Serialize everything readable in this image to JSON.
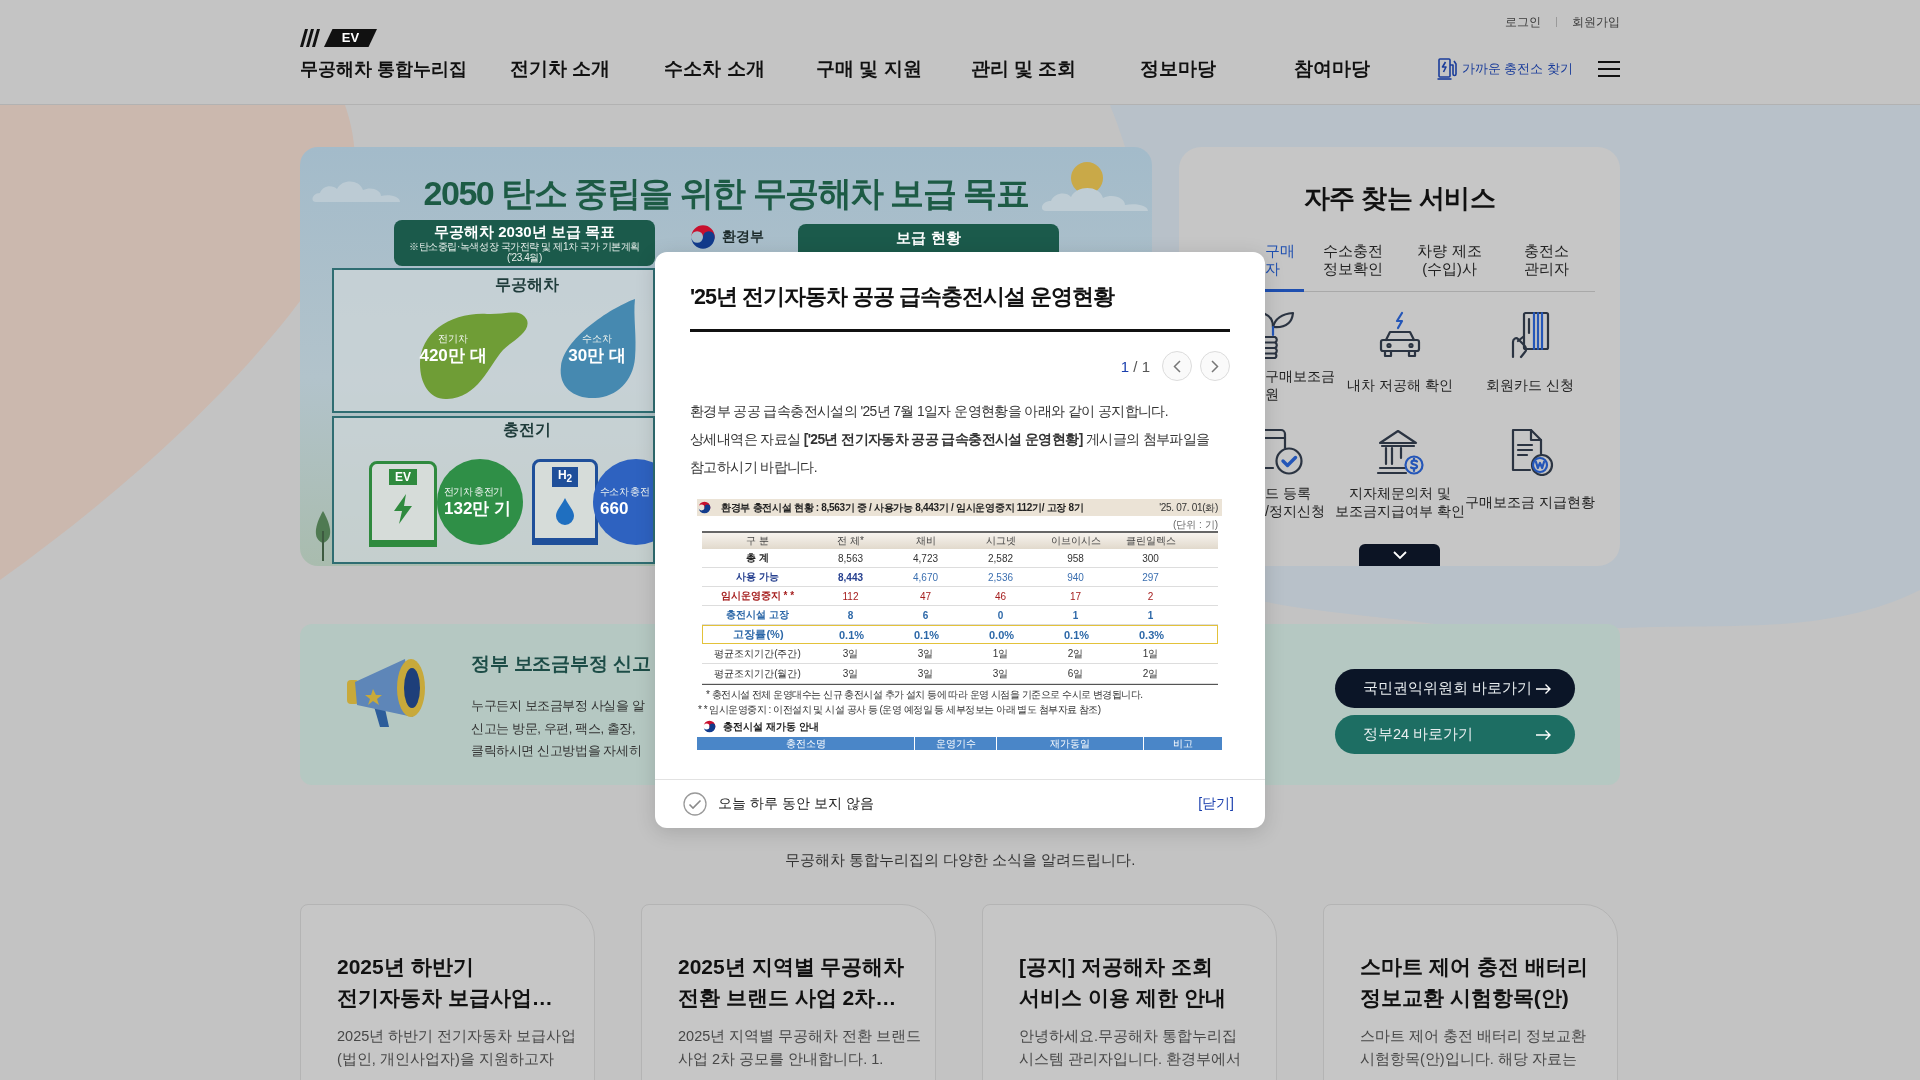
{
  "header": {
    "logo_badge": "EV",
    "site_title": "무공해차 통합누리집",
    "top_links": [
      "로그인",
      "회원가입"
    ],
    "nav": [
      "전기차 소개",
      "수소차 소개",
      "구매 및 지원",
      "관리 및 조회",
      "정보마당",
      "참여마당"
    ],
    "charger_search": "가까운 충전소 찾기"
  },
  "banner": {
    "title": "2050 탄소 중립을 위한 무공해차 보급 목표",
    "goal_heading": "무공해차 2030년 보급 목표",
    "goal_note": "※탄소중립·녹색성장 국가전략 및 제1차 국가 기본계획('23.4월)",
    "ministry": "환경부",
    "status_heading": "보급 현황",
    "vehicles_label": "무공해차",
    "vehicle_targets": [
      {
        "kind": "ev",
        "name": "전기차",
        "value": "420만 대"
      },
      {
        "kind": "hydrogen",
        "name": "수소차",
        "value": "30만 대"
      }
    ],
    "chargers_label": "충전기",
    "charger_targets": [
      {
        "kind": "ev",
        "pump_label": "EV",
        "name": "전기차 충전기",
        "value": "132만 기"
      },
      {
        "kind": "hydrogen",
        "pump_label": "H$_{2}$",
        "name": "수소차 충전",
        "value": "660"
      }
    ]
  },
  "services": {
    "title": "자주 찾는 서비스",
    "tabs": [
      {
        "label": "구매\n자",
        "selected": true
      },
      {
        "label": "수소충전\n정보확인",
        "selected": false
      },
      {
        "label": "차량 제조\n(수입)사",
        "selected": false
      },
      {
        "label": "충전소\n관리자",
        "selected": false
      }
    ],
    "items": [
      {
        "kind": "partial",
        "label": "구매보조금\n원"
      },
      {
        "kind": "full",
        "label": "내차 저공해 확인"
      },
      {
        "kind": "full",
        "label": "회원카드 신청"
      },
      {
        "kind": "partial",
        "label": "드 등록\n/정지신청"
      },
      {
        "kind": "full",
        "label": "지자체문의처 및\n보조금지급여부 확인"
      },
      {
        "kind": "full",
        "label": "구매보조금 지급현황"
      }
    ]
  },
  "report": {
    "title": "정부 보조금부정 신고",
    "text": "누구든지 보조금부정 사실을 알\n신고는 방문, 우편, 팩스, 출장,\n클릭하시면 신고방법을 자세히",
    "buttons": [
      {
        "kind": "dark",
        "label": "국민권익위원회 바로가기"
      },
      {
        "kind": "teal",
        "label": "정부24 바로가기"
      }
    ]
  },
  "news": {
    "subtitle": "무공해차 통합누리집의 다양한 소식을 알려드립니다.",
    "cards": [
      {
        "title": "2025년 하반기\n전기자동차 보급사업…",
        "summary": "2025년 하반기 전기자동차 보급사업\n(법인, 개인사업자)을 지원하고자"
      },
      {
        "title": "2025년 지역별 무공해차\n전환 브랜드 사업 2차…",
        "summary": "2025년 지역별 무공해차 전환 브랜드\n사업 2차 공모를 안내합니다. 1."
      },
      {
        "title": "[공지] 저공해차 조회\n서비스 이용 제한 안내",
        "summary": "안녕하세요.무공해차 통합누리집\n시스템 관리자입니다. 환경부에서"
      },
      {
        "title": "스마트 제어 충전 배터리\n정보교환 시험항목(안)",
        "summary": "스마트 제어 충전 배터리 정보교환\n시험항목(안)입니다. 해당 자료는"
      }
    ]
  },
  "notice_popup": {
    "title": "'25년 전기자동차 공공 급속충전시설 운영현황",
    "pager": {
      "current": "1",
      "separator": "/",
      "total": "1"
    },
    "body": "환경부 공공 급속충전시설의 '25년 7월 1일자 운영현황을 아래와 같이 공지합니다.\n상세내역은 자료실 **['25년 전기자동차 공공 급속충전시설 운영현황]** 게시글의 첨부파일을\n참고하시기 바랍니다.",
    "attachment": {
      "summary": "환경부 충전시설 현황 : 8,563기 중 / 사용가능 8,443기 / 임시운영중지 112기/ 고장 8기",
      "date": "'25. 07. 01(화)",
      "unit": "(단위 : 기)",
      "columns": [
        "구 분",
        "전 체*",
        "채비",
        "시그넷",
        "이브이시스",
        "클린일렉스"
      ],
      "rows": [
        {
          "kind": "total",
          "cells": [
            "총 계",
            "8,563",
            "4,723",
            "2,582",
            "958",
            "300"
          ]
        },
        {
          "kind": "available",
          "cells": [
            "사용 가능",
            "8,443",
            "4,670",
            "2,536",
            "940",
            "297"
          ]
        },
        {
          "kind": "suspended",
          "cells": [
            "임시운영중지 * *",
            "112",
            "47",
            "46",
            "17",
            "2"
          ]
        },
        {
          "kind": "fault",
          "cells": [
            "충전시설 고장",
            "8",
            "6",
            "0",
            "1",
            "1"
          ]
        },
        {
          "kind": "rate",
          "cells": [
            "고장률(%)",
            "0.1%",
            "0.1%",
            "0.0%",
            "0.1%",
            "0.3%"
          ]
        },
        {
          "kind": "period",
          "cells": [
            "평균조치기간(주간)",
            "3일",
            "3일",
            "1일",
            "2일",
            "1일"
          ]
        },
        {
          "kind": "period",
          "cells": [
            "평균조치기간(월간)",
            "3일",
            "3일",
            "3일",
            "6일",
            "2일"
          ]
        }
      ],
      "notes": [
        "* 충전시설 전체 운영대수는 신규 충전시설 추가 설치 등에 따라 운영 시점을 기준으로 수시로 변경됩니다.",
        "* * 임시운영중지 : 이전설치 및 시설 공사 등 (운영 예정일 등 세부정보는 아래 별도 첨부자료 참조)"
      ],
      "restart_title": "충전시설 재가동 안내",
      "restart_columns": [
        "충전소명",
        "운영기수",
        "재가동일",
        "비고"
      ]
    },
    "dismiss": {
      "label": "오늘 하루 동안 보지 않음",
      "checked": false
    },
    "close_label": "[닫기]"
  }
}
